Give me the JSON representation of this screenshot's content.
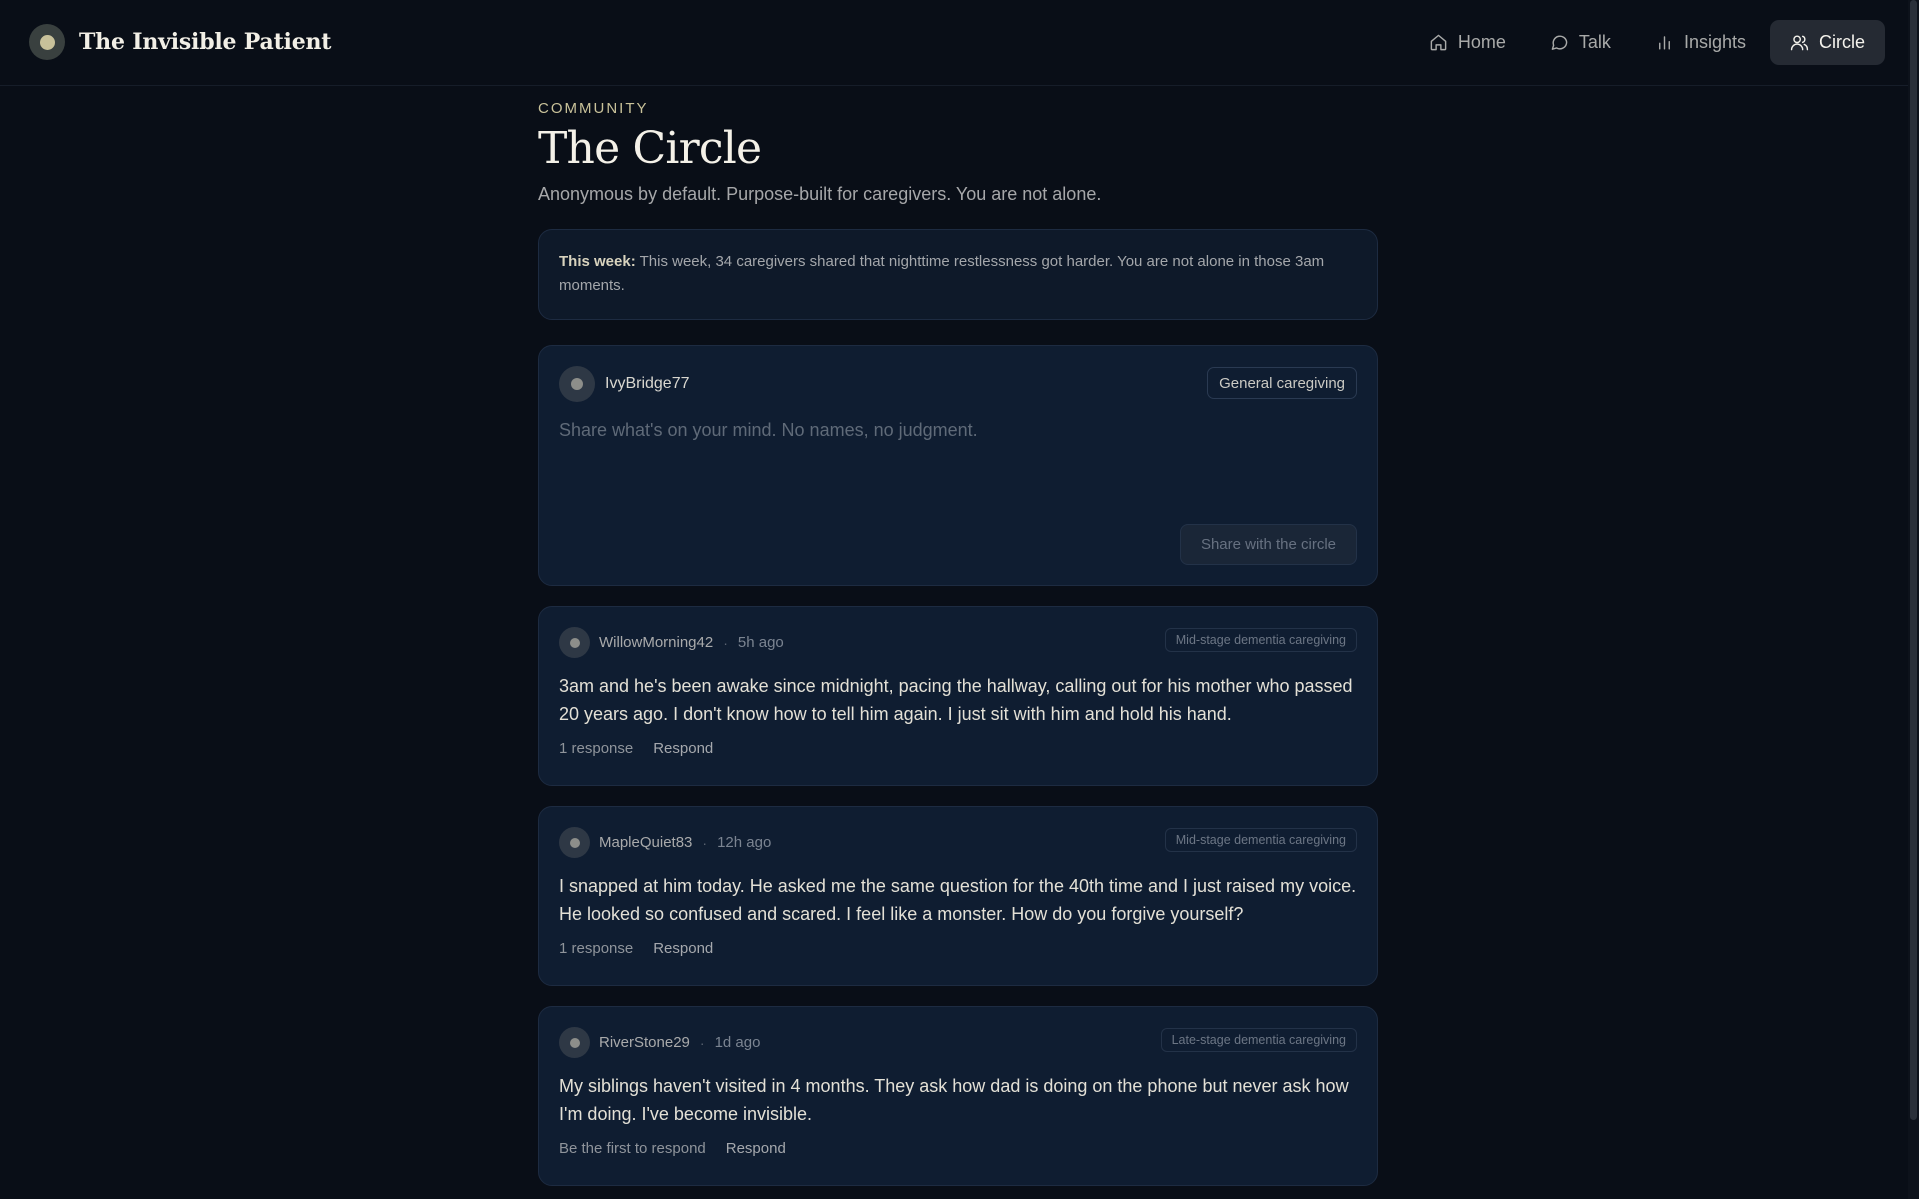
{
  "app": {
    "name": "The Invisible Patient"
  },
  "nav": {
    "items": [
      {
        "label": "Home",
        "icon": "home-icon",
        "active": false
      },
      {
        "label": "Talk",
        "icon": "chat-bubble-icon",
        "active": false
      },
      {
        "label": "Insights",
        "icon": "bar-chart-icon",
        "active": false
      },
      {
        "label": "Circle",
        "icon": "users-icon",
        "active": true
      }
    ]
  },
  "page": {
    "eyebrow": "COMMUNITY",
    "title": "The Circle",
    "subtitle": "Anonymous by default. Purpose-built for caregivers. You are not alone."
  },
  "banner": {
    "label": "This week:",
    "text": "This week, 34 caregivers shared that nighttime restlessness got harder. You are not alone in those 3am moments."
  },
  "composer": {
    "username": "IvyBridge77",
    "topic": "General caregiving",
    "placeholder": "Share what's on your mind. No names, no judgment.",
    "submit_label": "Share with the circle"
  },
  "posts": [
    {
      "username": "WillowMorning42",
      "separator": "·",
      "time": "5h ago",
      "tag": "Mid-stage dementia caregiving",
      "body": "3am and he's been awake since midnight, pacing the hallway, calling out for his mother who passed 20 years ago. I don't know how to tell him again. I just sit with him and hold his hand.",
      "responses": "1 response",
      "respond_label": "Respond"
    },
    {
      "username": "MapleQuiet83",
      "separator": "·",
      "time": "12h ago",
      "tag": "Mid-stage dementia caregiving",
      "body": "I snapped at him today. He asked me the same question for the 40th time and I just raised my voice. He looked so confused and scared. I feel like a monster. How do you forgive yourself?",
      "responses": "1 response",
      "respond_label": "Respond"
    },
    {
      "username": "RiverStone29",
      "separator": "·",
      "time": "1d ago",
      "tag": "Late-stage dementia caregiving",
      "body": "My siblings haven't visited in 4 months. They ask how dad is doing on the phone but never ask how I'm doing. I've become invisible.",
      "responses": "Be the first to respond",
      "respond_label": "Respond"
    }
  ],
  "colors": {
    "background": "#090e17",
    "card": "#0f1d31",
    "accent": "#c9c29a",
    "active_nav": "#252a33"
  }
}
